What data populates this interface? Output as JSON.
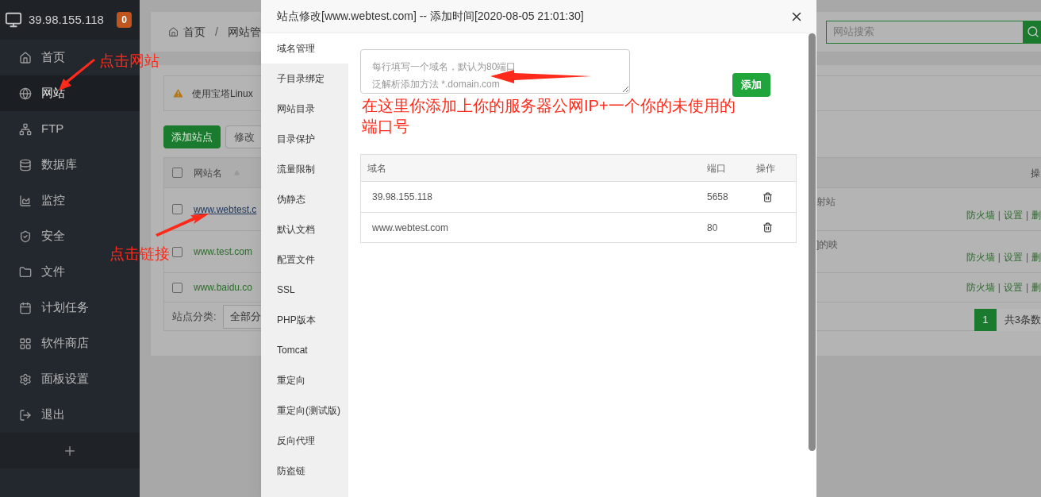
{
  "sidebar": {
    "server_ip": "39.98.155.118",
    "badge": "0",
    "items": [
      {
        "label": "首页",
        "selected": false
      },
      {
        "label": "网站",
        "selected": true
      },
      {
        "label": "FTP",
        "selected": false
      },
      {
        "label": "数据库",
        "selected": false
      },
      {
        "label": "监控",
        "selected": false
      },
      {
        "label": "安全",
        "selected": false
      },
      {
        "label": "文件",
        "selected": false
      },
      {
        "label": "计划任务",
        "selected": false
      },
      {
        "label": "软件商店",
        "selected": false
      },
      {
        "label": "面板设置",
        "selected": false
      },
      {
        "label": "退出",
        "selected": false
      }
    ]
  },
  "breadcrumb": {
    "items": [
      "首页",
      "网站管"
    ],
    "separator": "/"
  },
  "search": {
    "placeholder": "网站搜索"
  },
  "notice": "使用宝塔Linux",
  "toolbar": [
    "添加站点",
    "修改"
  ],
  "site_table": {
    "columns": [
      "网站名",
      "操"
    ],
    "all_checked": false,
    "separator": "|",
    "rows": [
      {
        "name": "www.webtest.c",
        "checked": false,
        "hovered": true,
        "note": "射站",
        "actions": [
          "防火墙",
          "设置",
          "删"
        ]
      },
      {
        "name": "www.test.com",
        "checked": false,
        "hovered": false,
        "note": "]的映",
        "actions": [
          "防火墙",
          "设置",
          "删"
        ]
      },
      {
        "name": "www.baidu.co",
        "checked": false,
        "hovered": false,
        "actions": [
          "防火墙",
          "设置",
          "删"
        ]
      }
    ]
  },
  "category": {
    "label": "站点分类:",
    "value": "全部分"
  },
  "pagination": {
    "pages": [
      {
        "label": "1",
        "selected": true
      }
    ],
    "summary": "共3条数"
  },
  "dialog": {
    "title": "站点修改[www.webtest.com] -- 添加时间[2020-08-05 21:01:30]",
    "tabs": [
      {
        "label": "域名管理",
        "selected": true
      },
      {
        "label": "子目录绑定",
        "selected": false
      },
      {
        "label": "网站目录",
        "selected": false
      },
      {
        "label": "目录保护",
        "selected": false
      },
      {
        "label": "流量限制",
        "selected": false
      },
      {
        "label": "伪静态",
        "selected": false
      },
      {
        "label": "默认文档",
        "selected": false
      },
      {
        "label": "配置文件",
        "selected": false
      },
      {
        "label": "SSL",
        "selected": false
      },
      {
        "label": "PHP版本",
        "selected": false
      },
      {
        "label": "Tomcat",
        "selected": false
      },
      {
        "label": "重定向",
        "selected": false
      },
      {
        "label": "重定向(测试版)",
        "selected": false
      },
      {
        "label": "反向代理",
        "selected": false
      },
      {
        "label": "防盗链",
        "selected": false
      }
    ],
    "domain_input": {
      "placeholder": [
        "每行填写一个域名，默认为80端口",
        "泛解析添加方法 *.domain.com"
      ]
    },
    "add_button": "添加",
    "domain_table": {
      "columns": [
        "域名",
        "端口",
        "操作"
      ],
      "rows": [
        {
          "domain": "39.98.155.118",
          "port": "5658"
        },
        {
          "domain": "www.webtest.com",
          "port": "80"
        }
      ]
    }
  },
  "annotations": [
    {
      "text": "点击网站"
    },
    {
      "text": "点击链接"
    },
    {
      "text": "在这里你添加上你的服务器公网IP+一个你的未使用的端口号"
    }
  ]
}
